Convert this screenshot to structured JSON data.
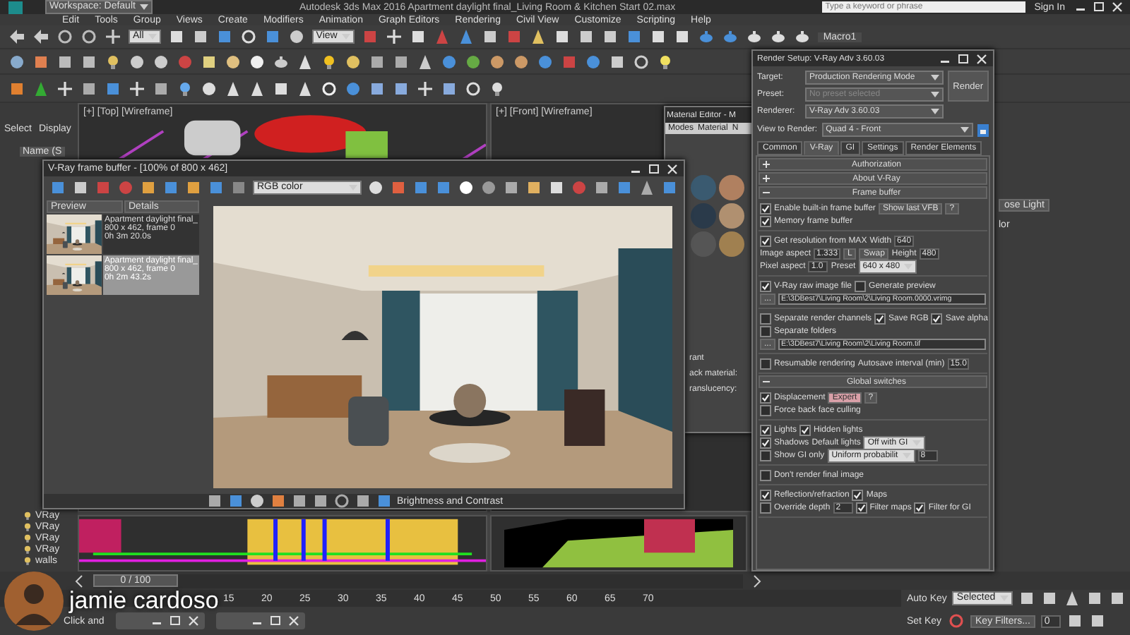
{
  "title_bar": {
    "workspace": "Workspace: Default",
    "title": "Autodesk 3ds Max 2016    Apartment daylight final_Living Room & Kitchen Start 02.max",
    "search": {
      "placeholder": "Type a keyword or phrase"
    },
    "sign_in": "Sign In"
  },
  "menu": [
    "Edit",
    "Tools",
    "Group",
    "Views",
    "Create",
    "Modifiers",
    "Animation",
    "Graph Editors",
    "Rendering",
    "Civil View",
    "Customize",
    "Scripting",
    "Help"
  ],
  "toolbar": {
    "selection_filter": "All",
    "reference_coord": "View",
    "macro": "Macro1"
  },
  "command_tabs": [
    "Select",
    "Display"
  ],
  "scene_explorer": {
    "column": "Name (S",
    "items": [
      "VRay",
      "VRay",
      "VRay",
      "VRay",
      "walls"
    ]
  },
  "viewports": [
    {
      "label": "[+] [Top] [Wireframe]"
    },
    {
      "label": "[+] [Front] [Wireframe]"
    }
  ],
  "material_editor": {
    "title": "Material Editor - M",
    "menu": [
      "Modes",
      "Material",
      "N"
    ],
    "labels": [
      "rant",
      "ack material:",
      "ranslucency:"
    ]
  },
  "frame_buffer": {
    "title": "V-Ray frame buffer - [100% of 800 x 462]",
    "channel": "RGB color",
    "history_columns": [
      "Preview",
      "Details"
    ],
    "history": [
      {
        "lines": [
          "Apartment daylight final_",
          "800 x 462, frame 0",
          "0h 3m 20.0s"
        ],
        "selected": false
      },
      {
        "lines": [
          "Apartment daylight final_",
          "800 x 462, frame 0",
          "0h 2m 43.2s"
        ],
        "selected": true
      }
    ],
    "footer": "Brightness and Contrast"
  },
  "render_setup": {
    "title": "Render Setup: V-Ray Adv 3.60.03",
    "fields": [
      {
        "label": "Target:",
        "value": "Production Rendering Mode",
        "disabled": false
      },
      {
        "label": "Preset:",
        "value": "No preset selected",
        "disabled": true
      },
      {
        "label": "Renderer:",
        "value": "V-Ray Adv 3.60.03",
        "disabled": false
      }
    ],
    "render_button": "Render",
    "view_to_render": {
      "label": "View to Render:",
      "value": "Quad 4 - Front"
    },
    "tabs": [
      {
        "label": "Common",
        "selected": false
      },
      {
        "label": "V-Ray",
        "selected": true
      },
      {
        "label": "GI",
        "selected": false
      },
      {
        "label": "Settings",
        "selected": false
      },
      {
        "label": "Render Elements",
        "selected": false
      }
    ],
    "rollouts": [
      {
        "title": "Authorization",
        "expanded": false
      },
      {
        "title": "About V-Ray",
        "expanded": false
      },
      {
        "title": "Frame buffer",
        "expanded": true,
        "groups": [
          [
            [
              {
                "kind": "checkbox",
                "label": "Enable built-in frame buffer",
                "checked": true
              },
              {
                "kind": "button",
                "label": "Show last VFB"
              },
              {
                "kind": "button",
                "label": "?"
              }
            ],
            [
              {
                "kind": "checkbox",
                "label": "Memory frame buffer",
                "checked": true
              }
            ]
          ],
          [
            [
              {
                "kind": "checkbox",
                "label": "Get resolution from MAX",
                "checked": true
              },
              {
                "kind": "label",
                "label": "Width"
              },
              {
                "kind": "spinner",
                "value": "640"
              }
            ],
            [
              {
                "kind": "label",
                "label": "Image aspect"
              },
              {
                "kind": "spinner",
                "value": "1.333"
              },
              {
                "kind": "button",
                "label": "L"
              },
              {
                "kind": "button",
                "label": "Swap"
              },
              {
                "kind": "label",
                "label": "Height"
              },
              {
                "kind": "spinner",
                "value": "480"
              }
            ],
            [
              {
                "kind": "label",
                "label": "Pixel aspect"
              },
              {
                "kind": "spinner",
                "value": "1.0"
              },
              {
                "kind": "label",
                "label": "Preset"
              },
              {
                "kind": "dropdown",
                "value": "640 x 480"
              }
            ]
          ],
          [
            [
              {
                "kind": "checkbox",
                "label": "V-Ray raw image file",
                "checked": true
              },
              {
                "kind": "checkbox",
                "label": "Generate preview",
                "checked": false
              }
            ],
            [
              {
                "kind": "button",
                "label": "..."
              },
              {
                "kind": "field",
                "value": "E:\\3DBest7\\Living Room\\2\\Living Room.0000.vrimg"
              }
            ]
          ],
          [
            [
              {
                "kind": "checkbox",
                "label": "Separate render channels",
                "checked": false
              },
              {
                "kind": "checkbox",
                "label": "Save RGB",
                "checked": true
              },
              {
                "kind": "checkbox",
                "label": "Save alpha",
                "checked": true
              }
            ],
            [
              {
                "kind": "checkbox",
                "label": "Separate folders",
                "checked": false
              }
            ],
            [
              {
                "kind": "button",
                "label": "..."
              },
              {
                "kind": "field",
                "value": "E:\\3DBest7\\Living Room\\2\\Living Room.tif"
              }
            ]
          ],
          [
            [
              {
                "kind": "checkbox",
                "label": "Resumable rendering",
                "checked": false
              },
              {
                "kind": "label",
                "label": "Autosave interval (min)"
              },
              {
                "kind": "spinner",
                "value": "15.0"
              }
            ]
          ]
        ]
      },
      {
        "title": "Global switches",
        "expanded": true,
        "groups": [
          [
            [
              {
                "kind": "checkbox",
                "label": "Displacement",
                "checked": true
              },
              {
                "kind": "toggle",
                "label": "Expert",
                "on": true
              },
              {
                "kind": "button",
                "label": "?"
              }
            ],
            [
              {
                "kind": "checkbox",
                "label": "Force back face culling",
                "checked": false
              }
            ]
          ],
          [
            [
              {
                "kind": "checkbox",
                "label": "Lights",
                "checked": true
              },
              {
                "kind": "checkbox",
                "label": "Hidden lights",
                "checked": true
              }
            ],
            [
              {
                "kind": "checkbox",
                "label": "Shadows",
                "checked": true
              },
              {
                "kind": "label",
                "label": "Default lights"
              },
              {
                "kind": "dropdown",
                "value": "Off with GI"
              }
            ],
            [
              {
                "kind": "checkbox",
                "label": "Show GI only",
                "checked": false
              },
              {
                "kind": "dropdown",
                "value": "Uniform probabilit"
              },
              {
                "kind": "spinner",
                "value": "8"
              }
            ]
          ],
          [
            [
              {
                "kind": "checkbox",
                "label": "Don't render final image",
                "checked": false
              }
            ]
          ],
          [
            [
              {
                "kind": "checkbox",
                "label": "Reflection/refraction",
                "checked": true
              },
              {
                "kind": "checkbox",
                "label": "Maps",
                "checked": true
              }
            ],
            [
              {
                "kind": "checkbox",
                "label": "Override depth",
                "checked": false
              },
              {
                "kind": "spinner",
                "value": "2"
              },
              {
                "kind": "checkbox",
                "label": "Filter maps",
                "checked": true
              },
              {
                "kind": "checkbox",
                "label": "Filter for GI",
                "checked": true
              }
            ]
          ]
        ]
      }
    ]
  },
  "command_panel": {
    "button": "ose Light",
    "label": "lor"
  },
  "timeline": {
    "position": "0 / 100",
    "level": 0,
    "ticks": [
      "15",
      "20",
      "25",
      "30",
      "35",
      "40",
      "45",
      "50",
      "55",
      "60",
      "65",
      "70"
    ]
  },
  "status": {
    "prompt": "Click and"
  },
  "animation": {
    "auto_key": "Auto Key",
    "key_mode": "Selected",
    "set_key": "Set Key",
    "key_filters": "Key Filters...",
    "frame": "0"
  },
  "presenter": {
    "name": "jamie cardoso"
  }
}
